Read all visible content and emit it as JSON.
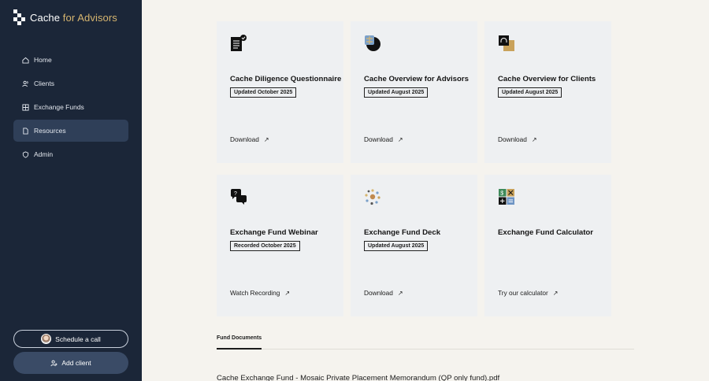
{
  "brand": {
    "name": "Cache",
    "accent": "for Advisors"
  },
  "sidebar": {
    "items": [
      {
        "label": "Home",
        "icon": "home-icon"
      },
      {
        "label": "Clients",
        "icon": "users-icon"
      },
      {
        "label": "Exchange Funds",
        "icon": "grid-icon"
      },
      {
        "label": "Resources",
        "icon": "document-icon",
        "active": true
      },
      {
        "label": "Admin",
        "icon": "shield-icon"
      }
    ],
    "schedule_label": "Schedule a call",
    "add_client_label": "Add client"
  },
  "cards": [
    {
      "title": "Cache Diligence Questionnaire",
      "badge": "Updated October 2025",
      "link": "Download",
      "icon": "checklist-icon"
    },
    {
      "title": "Cache Overview for Advisors",
      "badge": "Updated August 2025",
      "link": "Download",
      "icon": "globe-icon"
    },
    {
      "title": "Cache Overview for Clients",
      "badge": "Updated August 2025",
      "link": "Download",
      "icon": "headphones-icon"
    },
    {
      "title": "Exchange Fund Webinar",
      "badge": "Recorded October 2025",
      "link": "Watch Recording",
      "icon": "chat-bubbles-icon"
    },
    {
      "title": "Exchange Fund Deck",
      "badge": "Updated August 2025",
      "link": "Download",
      "icon": "dots-cluster-icon"
    },
    {
      "title": "Exchange Fund Calculator",
      "badge": "",
      "link": "Try our calculator",
      "icon": "calculator-icon"
    }
  ],
  "tabs": {
    "fund_documents": "Fund Documents"
  },
  "documents": [
    "Cache Exchange Fund - Mosaic Private Placement Memorandum (QP only fund).pdf"
  ],
  "arrow_glyph": "↗",
  "colors": {
    "sidebar": "#1b2638",
    "accent": "#d6b56f",
    "active_nav": "#2f3f58",
    "card_bg": "#eef0f2"
  }
}
